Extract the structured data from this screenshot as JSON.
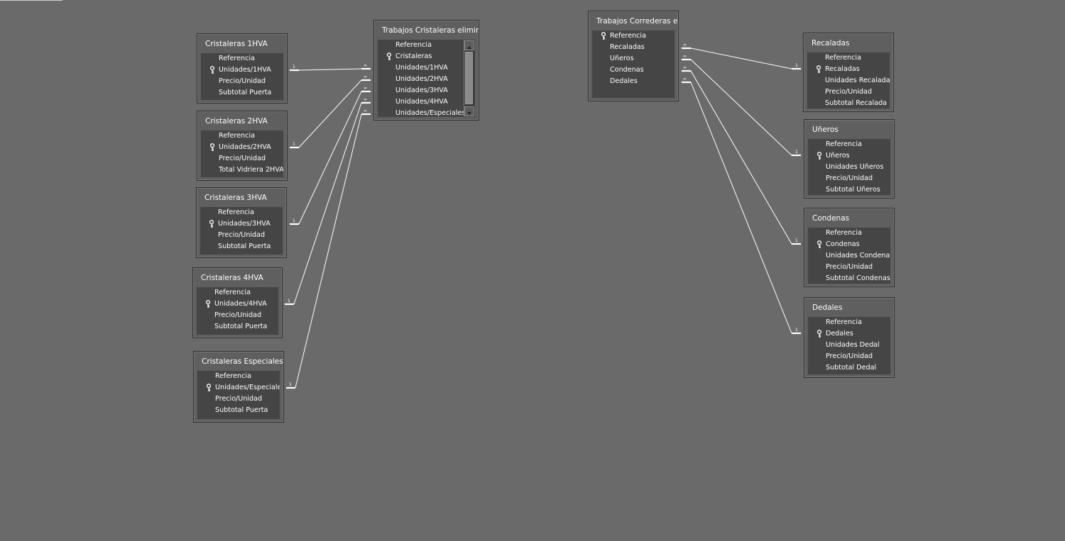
{
  "tables": {
    "cristaleras_1hva": {
      "title": "Cristaleras 1HVA",
      "fields": [
        "Referencia",
        "Unidades/1HVA",
        "Precio/Unidad",
        "Subtotal Puerta"
      ]
    },
    "cristaleras_2hva": {
      "title": "Cristaleras 2HVA",
      "fields": [
        "Referencia",
        "Unidades/2HVA",
        "Precio/Unidad",
        "Total Vidriera 2HVA"
      ]
    },
    "cristaleras_3hva": {
      "title": "Cristaleras 3HVA",
      "fields": [
        "Referencia",
        "Unidades/3HVA",
        "Precio/Unidad",
        "Subtotal Puerta"
      ]
    },
    "cristaleras_4hva": {
      "title": "Cristaleras 4HVA",
      "fields": [
        "Referencia",
        "Unidades/4HVA",
        "Precio/Unidad",
        "Subtotal Puerta"
      ]
    },
    "cristaleras_especiales": {
      "title": "Cristaleras Especiales",
      "fields": [
        "Referencia",
        "Unidades/Especiales",
        "Precio/Unidad",
        "Subtotal Puerta"
      ]
    },
    "trabajos_cristaleras": {
      "title": "Trabajos Cristaleras elimin...",
      "fields": [
        "Referencia",
        "Cristaleras",
        "Unidades/1HVA",
        "Unidades/2HVA",
        "Unidades/3HVA",
        "Unidades/4HVA",
        "Unidades/Especiales"
      ]
    },
    "trabajos_correderas": {
      "title": "Trabajos Correderas el...",
      "fields": [
        "Referencia",
        "Recaladas",
        "Uñeros",
        "Condenas",
        "Dedales"
      ]
    },
    "recaladas": {
      "title": "Recaladas",
      "fields": [
        "Referencia",
        "Recaladas",
        "Unidades Recalada",
        "Precio/Unidad",
        "Subtotal Recalada"
      ]
    },
    "uneros": {
      "title": "Uñeros",
      "fields": [
        "Referencia",
        "Uñeros",
        "Unidades Uñeros",
        "Precio/Unidad",
        "Subtotal Uñeros"
      ]
    },
    "condenas": {
      "title": "Condenas",
      "fields": [
        "Referencia",
        "Condenas",
        "Unidades Condena",
        "Precio/Unidad",
        "Subtotal Condenas"
      ]
    },
    "dedales": {
      "title": "Dedales",
      "fields": [
        "Referencia",
        "Dedales",
        "Unidades Dedal",
        "Precio/Unidad",
        "Subtotal Dedal"
      ]
    }
  },
  "relationships": {
    "one_label": "1",
    "many_label": "∞"
  },
  "icons": {
    "primary_key": "key-icon",
    "scroll_up": "scroll-up-arrow-icon",
    "scroll_down": "scroll-down-arrow-icon"
  },
  "colors": {
    "canvas": "#6a6a6a",
    "table_frame": "#5f5f5f",
    "field_list": "#454545",
    "line": "#ffffff"
  }
}
